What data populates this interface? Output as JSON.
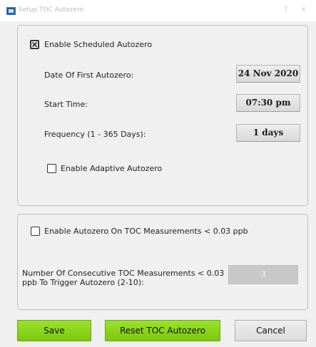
{
  "window": {
    "title": "Setup TOC Autozero",
    "help_glyph": "?",
    "close_glyph": "×",
    "icon": "app-window-icon"
  },
  "scheduled": {
    "enable_label": "Enable Scheduled Autozero",
    "enable_checked": true,
    "date_label": "Date Of First Autozero:",
    "date_value": "24 Nov 2020",
    "time_label": "Start Time:",
    "time_value": "07:30 pm",
    "freq_label": "Frequency (1 - 365 Days):",
    "freq_value": "1 days",
    "adaptive_label": "Enable Adaptive Autozero",
    "adaptive_checked": false
  },
  "toc": {
    "enable_label": "Enable Autozero On TOC Measurements < 0.03 ppb",
    "enable_checked": false,
    "count_label_line1": "Number Of Consecutive TOC Measurements < 0.03",
    "count_label_line2": "ppb To Trigger Autozero (2-10):",
    "count_value": "3"
  },
  "buttons": {
    "save": "Save",
    "reset": "Reset TOC Autozero",
    "cancel": "Cancel"
  },
  "colors": {
    "accent_green": "#8fd91c",
    "dialog_bg": "#f0f0f0"
  }
}
